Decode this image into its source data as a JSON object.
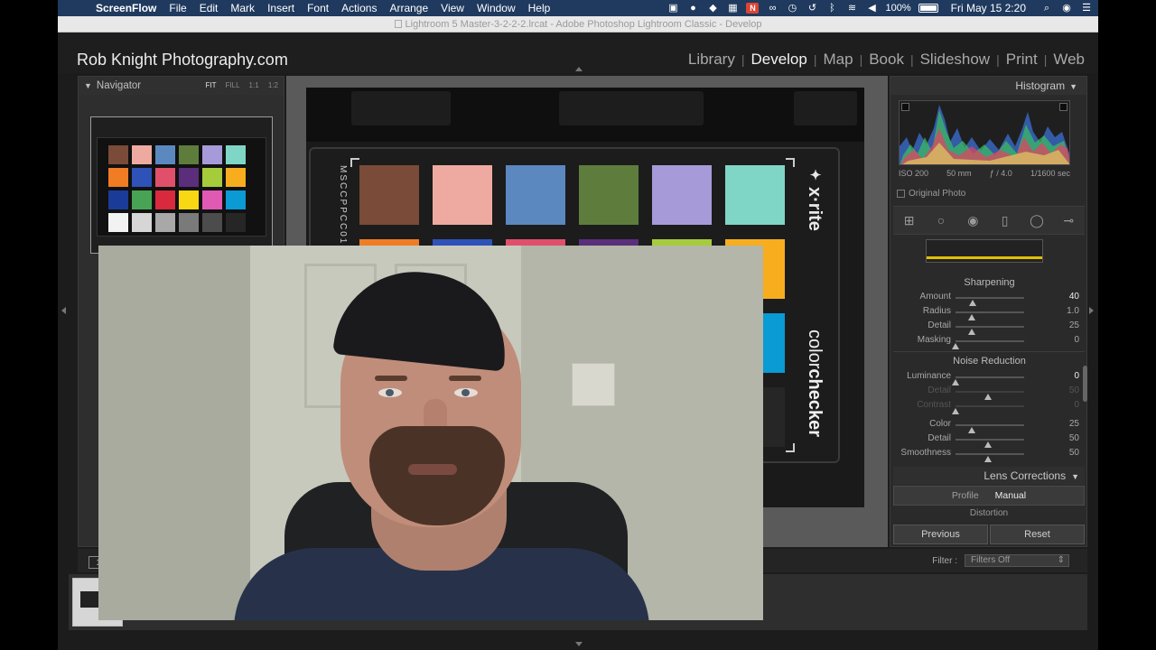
{
  "menubar": {
    "app_name": "ScreenFlow",
    "items": [
      "File",
      "Edit",
      "Mark",
      "Insert",
      "Font",
      "Actions",
      "Arrange",
      "View",
      "Window",
      "Help"
    ],
    "battery": "100%",
    "clock": "Fri May 15  2:20"
  },
  "window": {
    "title": "Lightroom 5 Master-3-2-2-2.lrcat - Adobe Photoshop Lightroom Classic - Develop"
  },
  "lightroom": {
    "identity_plate": "Rob Knight Photography.com",
    "modules": [
      {
        "label": "Library"
      },
      {
        "label": "Develop"
      },
      {
        "label": "Map"
      },
      {
        "label": "Book"
      },
      {
        "label": "Slideshow"
      },
      {
        "label": "Print"
      },
      {
        "label": "Web"
      }
    ],
    "active_module": "Develop"
  },
  "navigator": {
    "title": "Navigator",
    "zoom_options": [
      "FIT",
      "FILL",
      "1:1",
      "1:2"
    ],
    "selected_zoom": "FIT"
  },
  "colorchecker": {
    "brand": "x·rite",
    "name_light": "color",
    "name_bold": "checker",
    "serial": "MSCCPPCC01",
    "swatches": [
      "#7a4b38",
      "#eeaaa0",
      "#5c88c0",
      "#5e7d3c",
      "#a79ad8",
      "#7fd6c6",
      "#f07c24",
      "#2e52b8",
      "#e0506a",
      "#5a2e7a",
      "#a6cc3c",
      "#f7ad1e",
      "#1a3c98",
      "#48a454",
      "#d82a3c",
      "#f8d814",
      "#e05ab4",
      "#0a9ad4",
      "#f2f2f2",
      "#d6d6d6",
      "#a8a8a8",
      "#7a7a7a",
      "#4c4c4c",
      "#262626"
    ]
  },
  "histogram": {
    "title": "Histogram",
    "iso": "ISO 200",
    "focal": "50 mm",
    "aperture": "ƒ / 4.0",
    "shutter": "1/1600 sec",
    "original_photo_label": "Original Photo"
  },
  "detail": {
    "sharpening_title": "Sharpening",
    "sharpening": [
      {
        "label": "Amount",
        "value": "40",
        "pct": 0.27
      },
      {
        "label": "Radius",
        "value": "1.0",
        "pct": 0.25
      },
      {
        "label": "Detail",
        "value": "25",
        "pct": 0.25
      },
      {
        "label": "Masking",
        "value": "0",
        "pct": 0.0
      }
    ],
    "noise_title": "Noise Reduction",
    "noise": [
      {
        "label": "Luminance",
        "value": "0",
        "pct": 0.0
      },
      {
        "label": "Detail",
        "value": "50",
        "pct": 0.5
      },
      {
        "label": "Contrast",
        "value": "0",
        "pct": 0.0
      },
      {
        "label": "Color",
        "value": "25",
        "pct": 0.25
      },
      {
        "label": "Detail",
        "value": "50",
        "pct": 0.5
      },
      {
        "label": "Smoothness",
        "value": "50",
        "pct": 0.5
      }
    ]
  },
  "lens": {
    "title": "Lens Corrections",
    "tabs": [
      "Profile",
      "Manual"
    ],
    "active_tab": "Manual",
    "section": "Distortion"
  },
  "buttons": {
    "previous": "Previous",
    "reset": "Reset"
  },
  "filmstrip": {
    "page_label": "1",
    "filter_label": "Filter :",
    "filter_value": "Filters Off"
  }
}
